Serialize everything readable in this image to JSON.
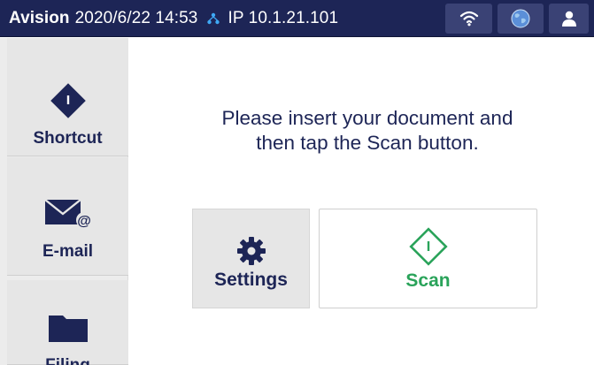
{
  "status_bar": {
    "brand": "Avision",
    "datetime": "2020/6/22 14:53",
    "ip": "IP 10.1.21.101",
    "icons": [
      "network-icon",
      "wifi-icon",
      "globe-icon",
      "user-icon"
    ]
  },
  "sidebar": {
    "items": [
      {
        "label": "Shortcut",
        "icon": "diamond-icon"
      },
      {
        "label": "E-mail",
        "icon": "email-icon"
      },
      {
        "label": "Filing",
        "icon": "folder-icon"
      }
    ]
  },
  "main": {
    "message_line1": "Please insert your document and",
    "message_line2": "then tap the Scan button.",
    "settings_label": "Settings",
    "scan_label": "Scan"
  },
  "colors": {
    "status_bar_bg": "#1d2556",
    "text_primary": "#1d2556",
    "scan_accent": "#2aa35a",
    "sidebar_bg": "#ececec"
  }
}
